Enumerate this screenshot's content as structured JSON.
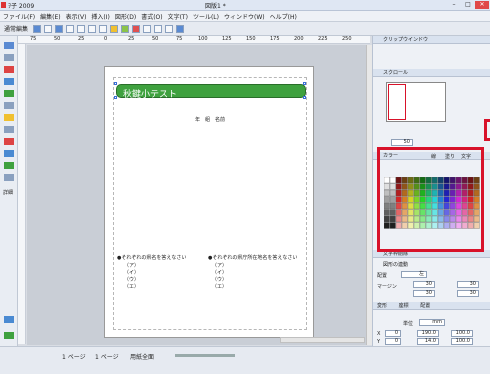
{
  "titlebar": {
    "app_title": "ｦ子 2009",
    "doc_title": "図版1 *"
  },
  "menubar": {
    "items": [
      "ファイル(F)",
      "編集(E)",
      "表示(V)",
      "挿入(I)",
      "図形(D)",
      "書式(O)",
      "文字(T)",
      "ツール(L)",
      "ウィンドウ(W)",
      "ヘルプ(H)"
    ]
  },
  "toolbar": {
    "mode_label": "通常編集"
  },
  "left_tools": {
    "label": "詳細"
  },
  "ruler": {
    "ticks": [
      "75",
      "50",
      "25",
      "0",
      "25",
      "50",
      "75",
      "100",
      "125",
      "150",
      "175",
      "200",
      "225",
      "250"
    ]
  },
  "document": {
    "title_text": "秋鍵小テスト",
    "name_line": "年　組　名前",
    "q1_heading": "●それぞれの県名を答えなさい",
    "q2_heading": "●それぞれの県庁所在地名を答えなさい",
    "q1_options": [
      "（ア）",
      "（イ）",
      "（ウ）",
      "（エ）"
    ],
    "q2_options": [
      "（ア）",
      "（イ）",
      "（ウ）",
      "（エ）"
    ]
  },
  "statusbar": {
    "page_label": "1 ページ",
    "page_total": "1 ページ",
    "view_label": "用紙全面"
  },
  "right_panel": {
    "clip_title": "クリップウインドウ",
    "scroll_label": "スクロール",
    "zoom_value": "50",
    "color_title": "カラー",
    "color_tabs": [
      "線",
      "塗り",
      "文字"
    ],
    "text_frame_title": "文字枠削除",
    "auto_link_label": "図形の連動",
    "align_label": "配置",
    "align_value": "左",
    "margin_label": "マージン",
    "margin_values": [
      "30",
      "30",
      "30",
      "30"
    ],
    "tabs": [
      "変形",
      "座標",
      "配置"
    ],
    "unit_label": "単位",
    "unit_value": "mm",
    "coord_labels": [
      "X",
      "Y",
      "θ"
    ],
    "coord_values": [
      "0",
      "0",
      "0"
    ],
    "size_values": [
      "190.0",
      "14.0"
    ],
    "percent_values": [
      "100.0",
      "100.0",
      "0"
    ]
  },
  "colors": {
    "accent_red": "#d8122a",
    "title_green": "#3fa13f"
  }
}
